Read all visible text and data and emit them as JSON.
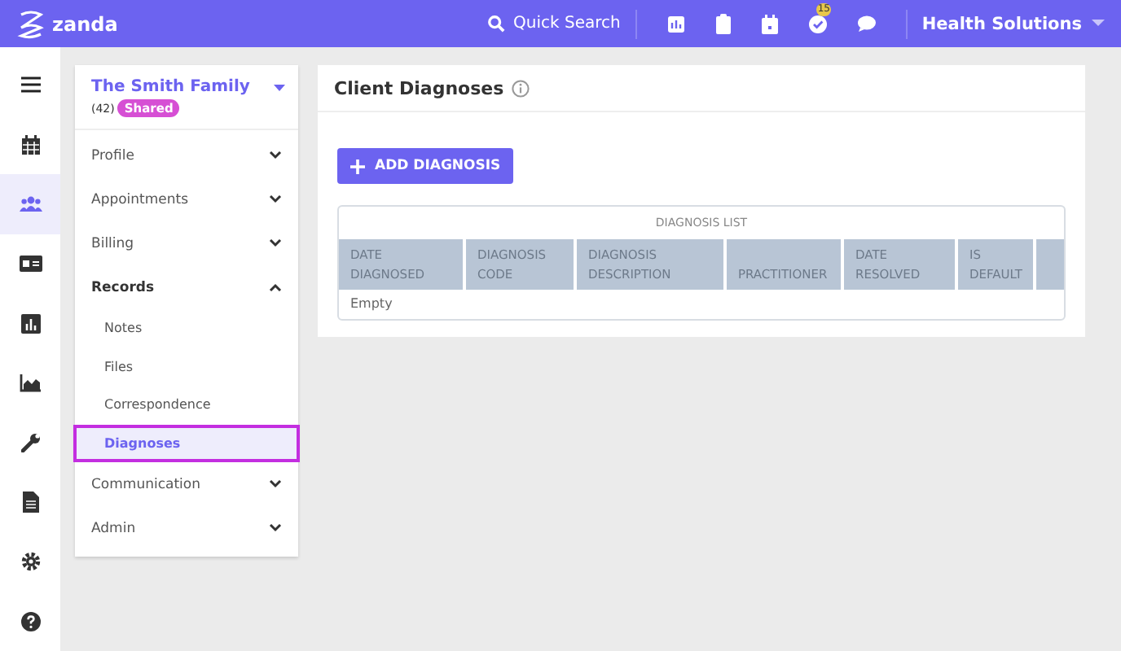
{
  "topbar": {
    "logo": "zanda",
    "search": "Quick Search",
    "badge": "15",
    "account": "Health Solutions"
  },
  "rail": [
    {
      "kind": "menu",
      "selected": false
    },
    {
      "kind": "calendar",
      "selected": false
    },
    {
      "kind": "people",
      "selected": true
    },
    {
      "kind": "card",
      "selected": false
    },
    {
      "kind": "bars",
      "selected": false
    },
    {
      "kind": "area",
      "selected": false
    },
    {
      "kind": "wrench",
      "selected": false
    },
    {
      "kind": "doc",
      "selected": false
    },
    {
      "kind": "gear",
      "selected": false
    },
    {
      "kind": "help",
      "selected": false
    }
  ],
  "client": {
    "name": "The Smith Family",
    "count": "(42)",
    "tag": "Shared"
  },
  "nav": [
    {
      "label": "Profile",
      "expanded": false
    },
    {
      "label": "Appointments",
      "expanded": false
    },
    {
      "label": "Billing",
      "expanded": false
    },
    {
      "label": "Records",
      "expanded": true,
      "children": [
        {
          "label": "Notes",
          "selected": false
        },
        {
          "label": "Files",
          "selected": false
        },
        {
          "label": "Correspondence",
          "selected": false
        },
        {
          "label": "Diagnoses",
          "selected": true
        }
      ]
    },
    {
      "label": "Communication",
      "expanded": false
    },
    {
      "label": "Admin",
      "expanded": false
    }
  ],
  "page": {
    "title": "Client Diagnoses",
    "add_button": "ADD DIAGNOSIS"
  },
  "table": {
    "caption": "DIAGNOSIS LIST",
    "columns": [
      "DATE DIAGNOSED",
      "DIAGNOSIS CODE",
      "DIAGNOSIS DESCRIPTION",
      "PRACTITIONER",
      "DATE RESOLVED",
      "IS DEFAULT"
    ],
    "empty": "Empty"
  }
}
